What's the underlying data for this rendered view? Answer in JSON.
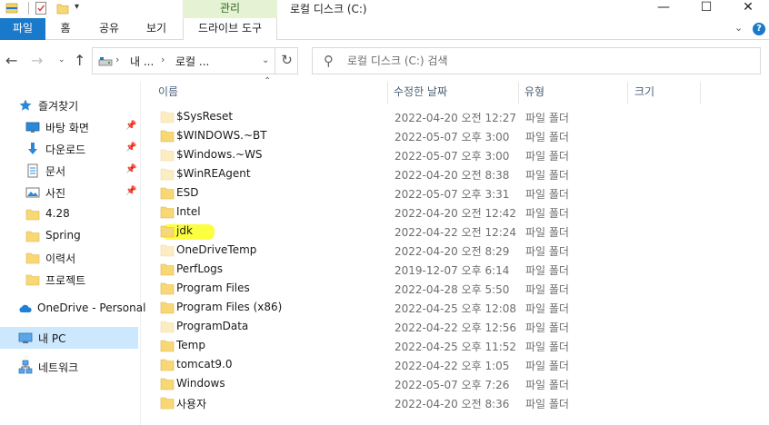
{
  "titlebar": {
    "context_tab": "관리",
    "title": "로컬 디스크 (C:)"
  },
  "ribbon": {
    "tabs": [
      "파일",
      "홈",
      "공유",
      "보기",
      "드라이브 도구"
    ]
  },
  "navbar": {
    "breadcrumb": [
      "내 ...",
      "로컬 ..."
    ],
    "search_placeholder": "로컬 디스크 (C:) 검색"
  },
  "sidebar": {
    "items": [
      {
        "label": "즐겨찾기",
        "icon": "star-icon"
      },
      {
        "label": "바탕 화면",
        "icon": "desktop-icon",
        "pinned": true
      },
      {
        "label": "다운로드",
        "icon": "download-icon",
        "pinned": true
      },
      {
        "label": "문서",
        "icon": "document-icon",
        "pinned": true
      },
      {
        "label": "사진",
        "icon": "pictures-icon",
        "pinned": true
      },
      {
        "label": "4.28",
        "icon": "folder-icon"
      },
      {
        "label": "Spring",
        "icon": "folder-icon"
      },
      {
        "label": "이력서",
        "icon": "folder-icon"
      },
      {
        "label": "프로젝트",
        "icon": "folder-icon"
      },
      {
        "label": "OneDrive - Personal",
        "icon": "cloud-icon"
      },
      {
        "label": "내 PC",
        "icon": "pc-icon",
        "selected": true
      },
      {
        "label": "네트워크",
        "icon": "network-icon"
      }
    ]
  },
  "filelist": {
    "columns": [
      "이름",
      "수정한 날짜",
      "유형",
      "크기"
    ],
    "rows": [
      {
        "name": "$SysReset",
        "date": "2022-04-20 오전 12:27",
        "type": "파일 폴더",
        "faded": true
      },
      {
        "name": "$WINDOWS.~BT",
        "date": "2022-05-07 오후 3:00",
        "type": "파일 폴더",
        "faded": false
      },
      {
        "name": "$Windows.~WS",
        "date": "2022-05-07 오후 3:00",
        "type": "파일 폴더",
        "faded": true
      },
      {
        "name": "$WinREAgent",
        "date": "2022-04-20 오전 8:38",
        "type": "파일 폴더",
        "faded": true
      },
      {
        "name": "ESD",
        "date": "2022-05-07 오후 3:31",
        "type": "파일 폴더",
        "faded": false
      },
      {
        "name": "Intel",
        "date": "2022-04-20 오전 12:42",
        "type": "파일 폴더",
        "faded": false
      },
      {
        "name": "jdk",
        "date": "2022-04-22 오전 12:24",
        "type": "파일 폴더",
        "faded": false,
        "highlighted": true
      },
      {
        "name": "OneDriveTemp",
        "date": "2022-04-20 오전 8:29",
        "type": "파일 폴더",
        "faded": true
      },
      {
        "name": "PerfLogs",
        "date": "2019-12-07 오후 6:14",
        "type": "파일 폴더",
        "faded": false
      },
      {
        "name": "Program Files",
        "date": "2022-04-28 오후 5:50",
        "type": "파일 폴더",
        "faded": false
      },
      {
        "name": "Program Files (x86)",
        "date": "2022-04-25 오후 12:08",
        "type": "파일 폴더",
        "faded": false
      },
      {
        "name": "ProgramData",
        "date": "2022-04-22 오후 12:56",
        "type": "파일 폴더",
        "faded": true
      },
      {
        "name": "Temp",
        "date": "2022-04-25 오후 11:52",
        "type": "파일 폴더",
        "faded": false
      },
      {
        "name": "tomcat9.0",
        "date": "2022-04-22 오후 1:05",
        "type": "파일 폴더",
        "faded": false
      },
      {
        "name": "Windows",
        "date": "2022-05-07 오후 7:26",
        "type": "파일 폴더",
        "faded": false
      },
      {
        "name": "사용자",
        "date": "2022-04-20 오전 8:36",
        "type": "파일 폴더",
        "faded": false
      }
    ]
  },
  "colors": {
    "file_tab": "#1979ca",
    "context_tab_bg": "#e5f2d4",
    "folder": "#f8d775",
    "folder_faded": "#fcecc2",
    "selected": "#cce8ff",
    "highlight": "#fbff2a"
  }
}
